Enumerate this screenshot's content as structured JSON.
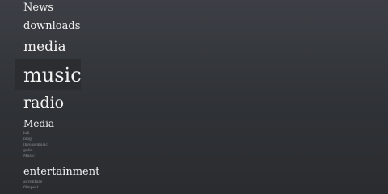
{
  "nav": {
    "items": [
      {
        "label": "News"
      },
      {
        "label": "downloads"
      },
      {
        "label": "media"
      },
      {
        "label": "music",
        "active": true
      },
      {
        "label": "radio"
      }
    ],
    "sections": [
      {
        "label": "Media",
        "subitems": [
          "hifi",
          "blog",
          "invoke music",
          "guild",
          "Music"
        ]
      },
      {
        "label": "entertainment",
        "subitems": [
          "adventure",
          "filmpost"
        ]
      }
    ]
  },
  "colors": {
    "background_top": "#3c3f45",
    "background_bottom": "#2a2c30",
    "text": "#f2f2f2",
    "subtext": "#8b8f95",
    "active_highlight": "#2b2d31"
  }
}
